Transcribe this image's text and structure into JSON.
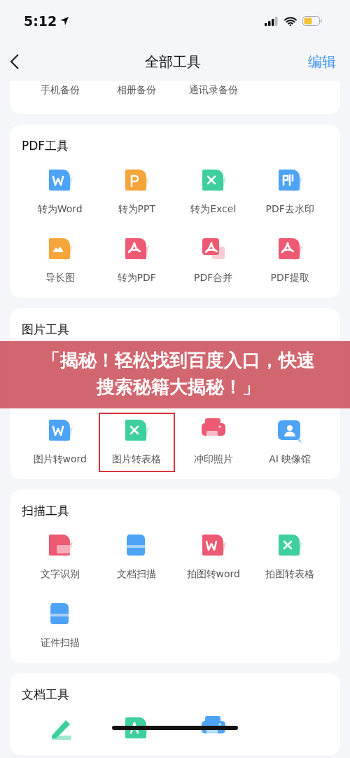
{
  "status_bar": {
    "time": "5:12"
  },
  "nav": {
    "title": "全部工具",
    "action": "编辑"
  },
  "backup_section": {
    "items": [
      {
        "label": "手机备份"
      },
      {
        "label": "相册备份"
      },
      {
        "label": "通讯录备份"
      }
    ]
  },
  "sections": [
    {
      "title": "PDF工具",
      "items": [
        {
          "label": "转为Word",
          "kind": "word",
          "color": "#4da3f5",
          "highlighted": false
        },
        {
          "label": "转为PPT",
          "kind": "ppt",
          "color": "#f5a53a",
          "highlighted": false
        },
        {
          "label": "转为Excel",
          "kind": "excel",
          "color": "#3ecf9e",
          "highlighted": false
        },
        {
          "label": "PDF去水印",
          "kind": "seal",
          "color": "#4da3f5",
          "highlighted": false
        },
        {
          "label": "导长图",
          "kind": "mountain",
          "color": "#f5a53a",
          "highlighted": false
        },
        {
          "label": "转为PDF",
          "kind": "pdf",
          "color": "#ee5a73",
          "highlighted": false
        },
        {
          "label": "PDF合并",
          "kind": "pdf-merge",
          "color": "#ee5a73",
          "highlighted": false
        },
        {
          "label": "PDF提取",
          "kind": "pdf-extract",
          "color": "#ee5a73",
          "highlighted": false
        }
      ]
    },
    {
      "title": "图片工具",
      "overlay_banner": {
        "text": "「揭秘！轻松找到百度入口，快速搜索秘籍大揭秘！」"
      },
      "items": [
        {
          "label": "图片转word",
          "kind": "word",
          "color": "#4da3f5",
          "highlighted": false
        },
        {
          "label": "图片转表格",
          "kind": "excel",
          "color": "#3ecf9e",
          "highlighted": true
        },
        {
          "label": "冲印照片",
          "kind": "printer",
          "color": "#ee5a73",
          "highlighted": false
        },
        {
          "label": "AI 映像馆",
          "kind": "portrait",
          "color": "#4da3f5",
          "highlighted": false
        }
      ]
    },
    {
      "title": "扫描工具",
      "items": [
        {
          "label": "文字识别",
          "kind": "ocr",
          "color": "#ee5a73",
          "highlighted": false
        },
        {
          "label": "文档扫描",
          "kind": "scanner",
          "color": "#4da3f5",
          "highlighted": false
        },
        {
          "label": "拍图转word",
          "kind": "word",
          "color": "#ee5a73",
          "highlighted": false
        },
        {
          "label": "拍图转表格",
          "kind": "excel",
          "color": "#3ecf9e",
          "highlighted": false
        },
        {
          "label": "证件扫描",
          "kind": "scanner",
          "color": "#4da3f5",
          "highlighted": false
        }
      ]
    },
    {
      "title": "文档工具",
      "items": [
        {
          "kind": "pencil",
          "color": "#3ecf9e",
          "highlighted": false
        },
        {
          "kind": "letter",
          "color": "#3ecf9e",
          "highlighted": false
        },
        {
          "kind": "printer",
          "color": "#4da3f5",
          "highlighted": false
        }
      ]
    }
  ]
}
